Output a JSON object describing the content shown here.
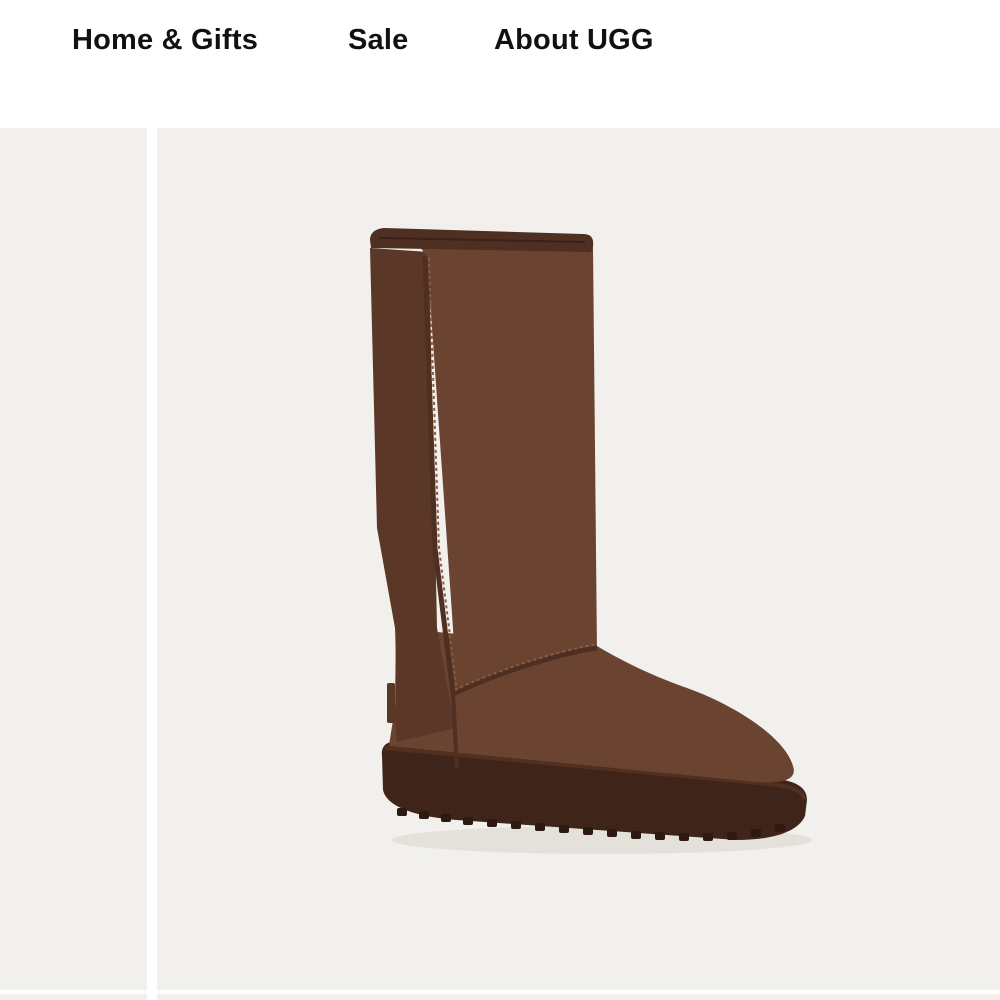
{
  "nav": {
    "items": [
      {
        "label": "Home & Gifts"
      },
      {
        "label": "Sale"
      },
      {
        "label": "About UGG"
      }
    ]
  },
  "product_image": {
    "subject": "tall-suede-boot",
    "colors": {
      "background": "#f1f0ec",
      "suede": "#6b4331",
      "suede_dark": "#4e2f22",
      "sole": "#3f2419",
      "stitch": "#8a5a43"
    }
  }
}
